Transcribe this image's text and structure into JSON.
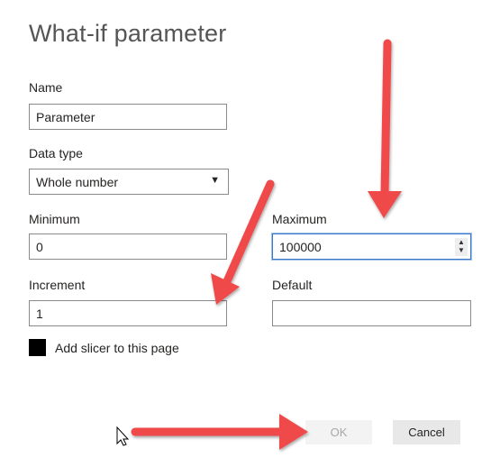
{
  "dialog": {
    "title": "What-if parameter",
    "name_label": "Name",
    "name_value": "Parameter",
    "data_type_label": "Data type",
    "data_type_value": "Whole number",
    "minimum_label": "Minimum",
    "minimum_value": "0",
    "maximum_label": "Maximum",
    "maximum_value": "100000",
    "increment_label": "Increment",
    "increment_value": "1",
    "default_label": "Default",
    "default_value": "",
    "slicer_label": "Add slicer to this page",
    "slicer_checked": false,
    "ok_label": "OK",
    "cancel_label": "Cancel"
  },
  "annotations": {
    "arrow_color": "#f04a4a"
  },
  "icons": {
    "dropdown": "caret-down-icon",
    "spinner": "spinner-icon",
    "cursor": "mouse-pointer-icon"
  }
}
